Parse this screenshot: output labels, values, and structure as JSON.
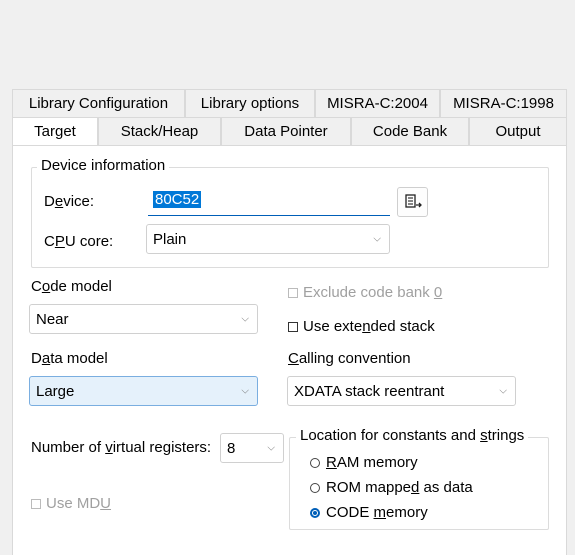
{
  "tabs_row1": [
    "Library Configuration",
    "Library options",
    "MISRA-C:2004",
    "MISRA-C:1998"
  ],
  "tabs_row2": [
    "Target",
    "Stack/Heap",
    "Data Pointer",
    "Code Bank",
    "Output"
  ],
  "device_group": {
    "legend": "Device information",
    "device_label_pre": "D",
    "device_label_u": "e",
    "device_label_post": "vice:",
    "device_value": "80C52",
    "cpu_label_pre": "C",
    "cpu_label_u": "P",
    "cpu_label_post": "U core:",
    "cpu_value": "Plain"
  },
  "code_model": {
    "label_pre": "C",
    "label_u": "o",
    "label_post": "de model",
    "value": "Near"
  },
  "data_model": {
    "label_pre": "D",
    "label_u": "a",
    "label_post": "ta model",
    "value": "Large"
  },
  "exclude_bank": {
    "label_pre": "Exclude code bank ",
    "label_u": "0",
    "checked": false,
    "enabled": false
  },
  "extended_stack": {
    "label_pre": "Use exte",
    "label_u": "n",
    "label_post": "ded stack",
    "checked": false
  },
  "calling_convention": {
    "label_u": "C",
    "label_post": "alling convention",
    "value": "XDATA stack reentrant"
  },
  "virtual_registers": {
    "label_pre": "Number of ",
    "label_u": "v",
    "label_post": "irtual registers:",
    "value": "8"
  },
  "use_mdu": {
    "label_pre": "Use MD",
    "label_u": "U",
    "enabled": false
  },
  "constants_group": {
    "legend_pre": "Location for constants and ",
    "legend_u": "s",
    "legend_post": "trings",
    "options": [
      {
        "pre": "",
        "u": "R",
        "post": "AM memory",
        "selected": false
      },
      {
        "pre": "ROM mappe",
        "u": "d",
        "post": " as data",
        "selected": false
      },
      {
        "pre": "CODE ",
        "u": "m",
        "post": "emory",
        "selected": true
      }
    ]
  }
}
